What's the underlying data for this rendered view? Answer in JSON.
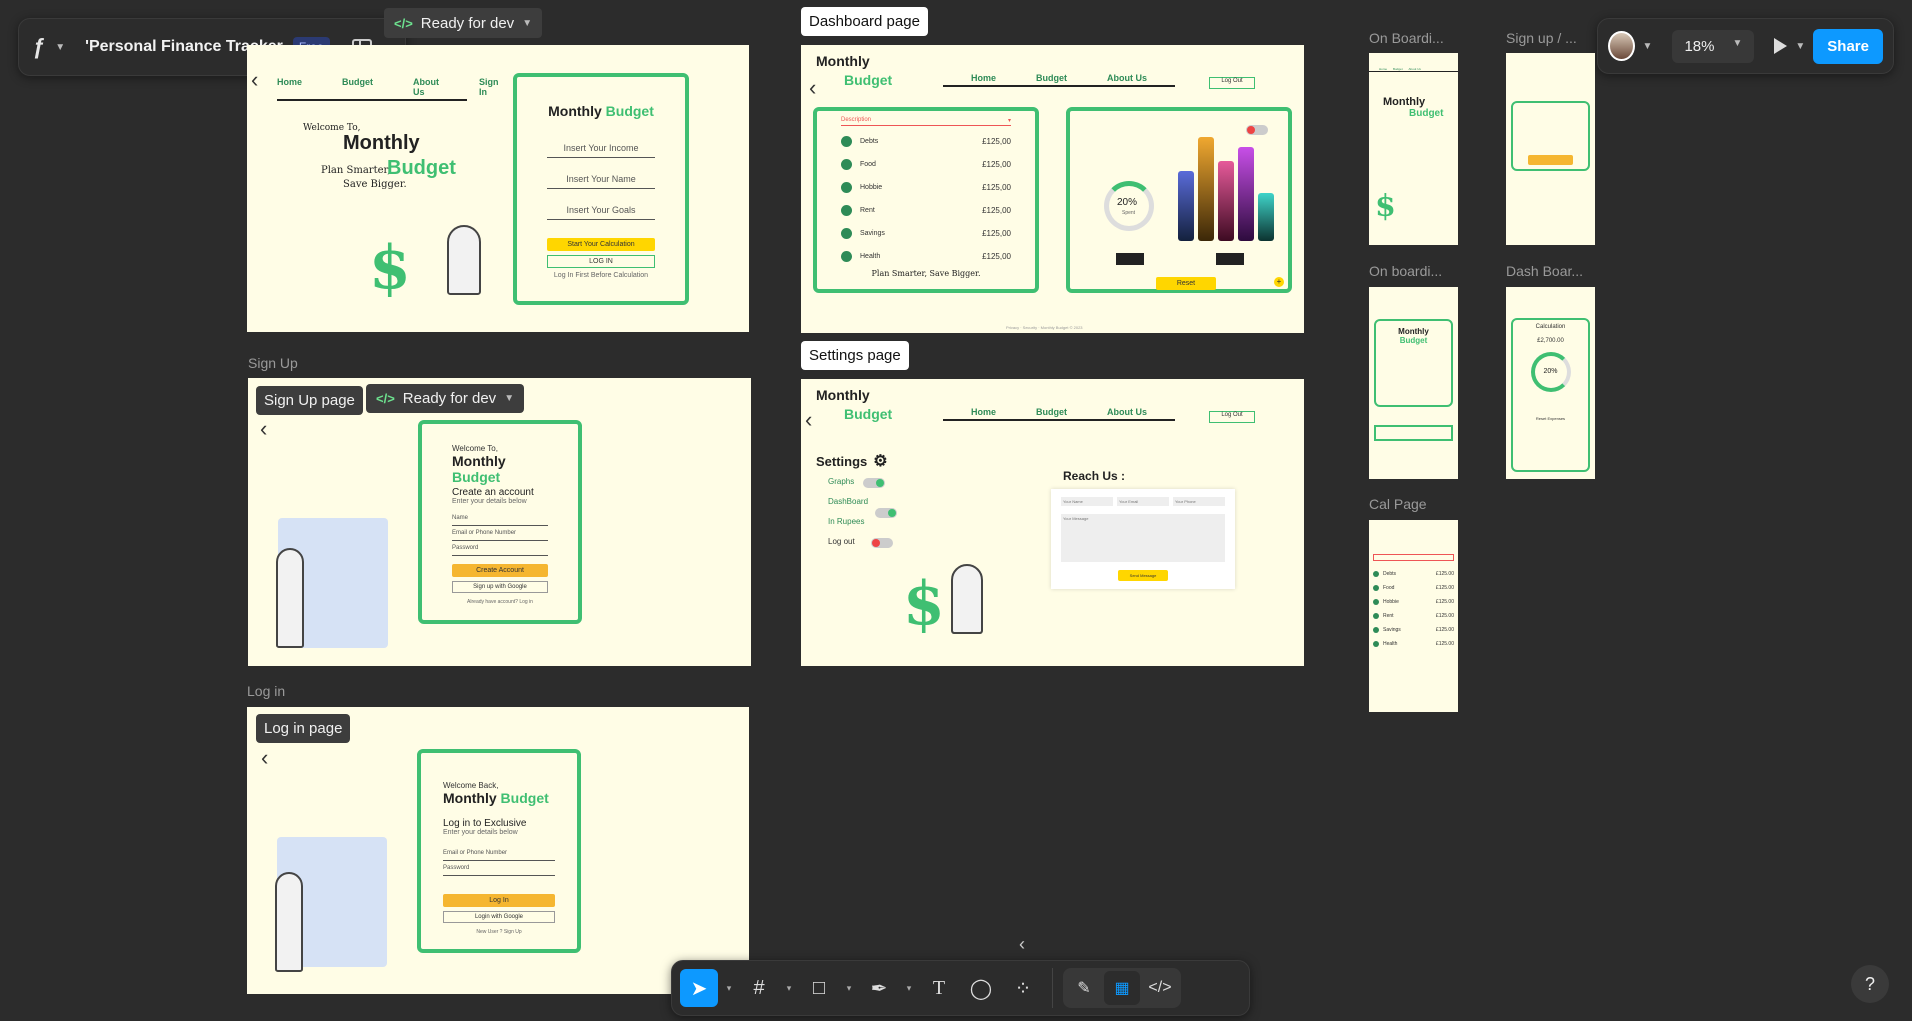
{
  "file": {
    "title": "'Personal Finance Tracker",
    "plan_badge": "Free"
  },
  "toprow": {
    "status_label": "Ready for dev"
  },
  "right": {
    "zoom": "18%",
    "share": "Share"
  },
  "sections": {
    "signup_label": "Sign Up",
    "login_label": "Log in",
    "signup_pill": "Sign Up page",
    "login_pill": "Log in page",
    "dashboard_pill": "Dashboard page",
    "settings_pill": "Settings page",
    "ready": "Ready for dev"
  },
  "nav": {
    "home": "Home",
    "budget": "Budget",
    "about": "About Us",
    "signin": "Sign In",
    "logout": "Log Out"
  },
  "brand": {
    "monthly": "Monthly",
    "budget": "Budget"
  },
  "onboarding": {
    "welcome": "Welcome To,",
    "monthly": "Monthly",
    "tag1": "Plan Smarter,",
    "budget": "Budget",
    "tag2": "Save Bigger.",
    "card_title_a": "Monthly",
    "card_title_b": "Budget",
    "income": "Insert Your Income",
    "name": "Insert Your Name",
    "goals": "Insert Your Goals",
    "start": "Start Your Calculation",
    "login": "LOG IN",
    "note": "Log In First Before Calculation"
  },
  "signup": {
    "welcome": "Welcome To,",
    "title_a": "Monthly",
    "title_b": "Budget",
    "create": "Create an account",
    "sub": "Enter your details below",
    "f1": "Name",
    "f2": "Email or Phone Number",
    "f3": "Password",
    "btn": "Create Account",
    "google": "Sign up with Google",
    "have": "Already have account?",
    "login": "Log in"
  },
  "login": {
    "welcome": "Welcome Back,",
    "title_a": "Monthly",
    "title_b": "Budget",
    "heading": "Log in to Exclusive",
    "sub": "Enter your details below",
    "f1": "Email or Phone Number",
    "f2": "Password",
    "btn": "Log In",
    "google": "Login with Google",
    "new": "New User ?",
    "signup": "Sign Up"
  },
  "dashboard": {
    "desc": "Description",
    "rows": [
      {
        "name": "Debts",
        "amount": "£125,00"
      },
      {
        "name": "Food",
        "amount": "£125,00"
      },
      {
        "name": "Hobbie",
        "amount": "£125,00"
      },
      {
        "name": "Rent",
        "amount": "£125,00"
      },
      {
        "name": "Savings",
        "amount": "£125,00"
      },
      {
        "name": "Health",
        "amount": "£125,00"
      }
    ],
    "slogan": "Plan Smarter, Save Bigger.",
    "percent": "20%",
    "spent": "Spent",
    "reset": "Reset",
    "footer": "Privacy · Security · Monthly Budget © 2023"
  },
  "settings": {
    "heading": "Settings",
    "graphs": "Graphs",
    "dashboard": "DashBoard",
    "rupees": "In Rupees",
    "logout": "Log out",
    "reach": "Reach Us :",
    "f1": "Your Name",
    "f2": "Your Email",
    "f3": "Your Phone",
    "msg": "Your Message",
    "send": "Send Message"
  },
  "mobile": {
    "onboard1": "On Boardi...",
    "signup": "Sign up / ...",
    "onboard2": "On boardi...",
    "dash": "Dash Boar...",
    "cal": "Cal Page",
    "calc": "Calculation",
    "amount": "£2,700.00",
    "percent": "20%",
    "reset": "Reset Expenses",
    "cal_rows": [
      "£125.00",
      "£125.00",
      "£125.00",
      "£125.00",
      "£125.00",
      "£125.00"
    ]
  },
  "icons": [
    "figma-icon",
    "sidebar-icon",
    "play-icon",
    "move-icon",
    "frame-icon",
    "rectangle-icon",
    "pen-icon",
    "text-icon",
    "comment-icon",
    "components-icon",
    "draw-icon",
    "design-mode-icon",
    "dev-mode-icon",
    "help-icon"
  ]
}
